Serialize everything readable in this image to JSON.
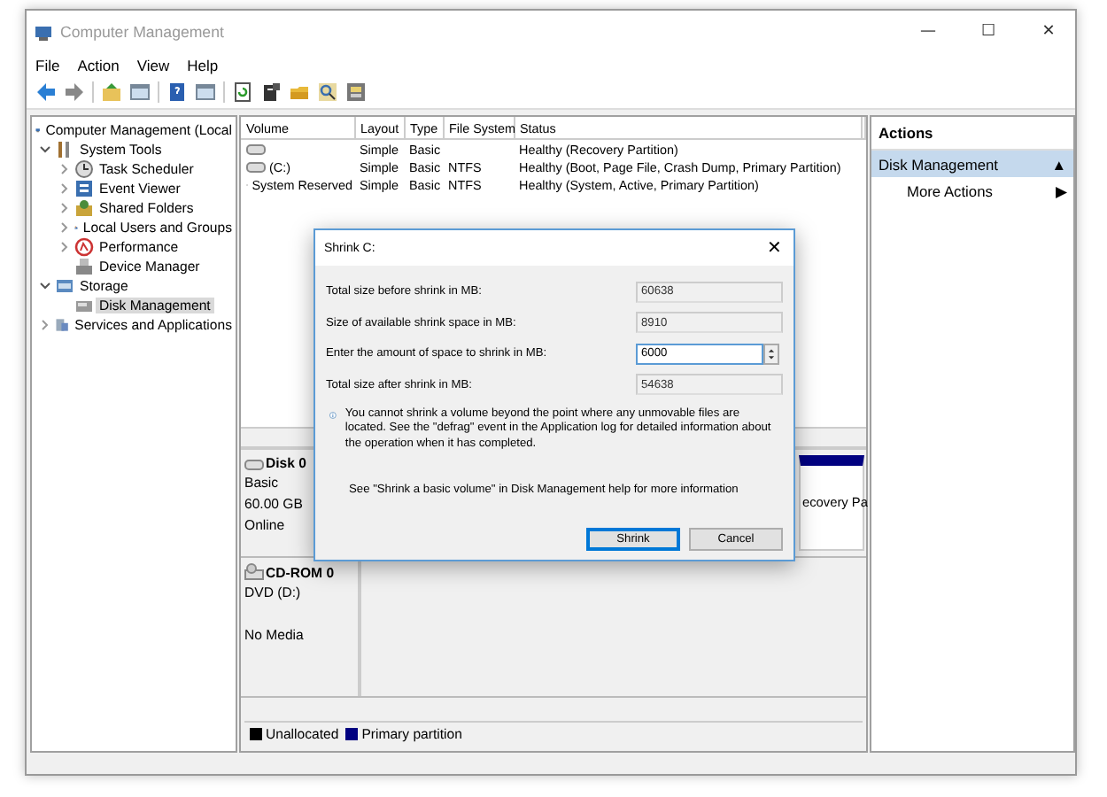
{
  "window": {
    "title": "Computer Management",
    "controls": [
      "—",
      "☐",
      "✕"
    ]
  },
  "menu": [
    "File",
    "Action",
    "View",
    "Help"
  ],
  "tree": [
    {
      "label": "Computer Management (Local",
      "kind": "root",
      "selected": false,
      "children": [
        {
          "label": "System Tools",
          "kind": "group",
          "expanded": true,
          "selected": false,
          "children": [
            {
              "label": "Task Scheduler",
              "kind": "group",
              "expanded": false,
              "selected": false
            },
            {
              "label": "Event Viewer",
              "kind": "group",
              "expanded": false,
              "selected": false
            },
            {
              "label": "Shared Folders",
              "kind": "group",
              "expanded": false,
              "selected": false
            },
            {
              "label": "Local Users and Groups",
              "kind": "group",
              "expanded": false,
              "selected": false
            },
            {
              "label": "Performance",
              "kind": "group",
              "expanded": false,
              "selected": false
            },
            {
              "label": "Device Manager",
              "kind": "leaf",
              "selected": false
            }
          ]
        },
        {
          "label": "Storage",
          "kind": "group",
          "expanded": true,
          "selected": false,
          "children": [
            {
              "label": "Disk Management",
              "kind": "leaf",
              "selected": true
            }
          ]
        },
        {
          "label": "Services and Applications",
          "kind": "group",
          "expanded": false,
          "selected": false
        }
      ]
    }
  ],
  "table": {
    "columns": [
      "Volume",
      "Layout",
      "Type",
      "File System",
      "Status"
    ],
    "rows": [
      {
        "volume": "",
        "layout": "Simple",
        "type": "Basic",
        "file_system": "",
        "status": "Healthy (Recovery Partition)"
      },
      {
        "volume": "(C:)",
        "layout": "Simple",
        "type": "Basic",
        "file_system": "NTFS",
        "status": "Healthy (Boot, Page File, Crash Dump, Primary Partition)"
      },
      {
        "volume": "System Reserved",
        "layout": "Simple",
        "type": "Basic",
        "file_system": "NTFS",
        "status": "Healthy (System, Active, Primary Partition)"
      }
    ]
  },
  "disks": [
    {
      "name": "Disk 0",
      "type": "Basic",
      "size": "60.00 GB",
      "status": "Online",
      "partition": "ecovery Pa"
    },
    {
      "name": "CD-ROM 0",
      "type": "DVD (D:)",
      "status": "No Media"
    }
  ],
  "legend": [
    {
      "label": "Unallocated",
      "color": "#000000"
    },
    {
      "label": "Primary partition",
      "color": "#000080"
    }
  ],
  "actions": {
    "title": "Actions",
    "items": [
      {
        "label": "Disk Management",
        "kind": "header",
        "marker": "▲"
      },
      {
        "label": "More Actions",
        "kind": "item",
        "marker": "▶"
      }
    ]
  },
  "dialog": {
    "title": "Shrink C:",
    "close": "✕",
    "fields": [
      {
        "label": "Total size before shrink in MB:",
        "value": "60638",
        "editable": false
      },
      {
        "label": "Size of available shrink space in MB:",
        "value": "8910",
        "editable": false
      },
      {
        "label": "Enter the amount of space to shrink in MB:",
        "value": "6000",
        "editable": true
      },
      {
        "label": "Total size after shrink in MB:",
        "value": "54638",
        "editable": false
      }
    ],
    "info": "You cannot shrink a volume beyond the point where any unmovable files are located. See the \"defrag\" event in the Application log for detailed information about the operation when it has completed.",
    "help": "See \"Shrink a basic volume\" in Disk Management help for more information",
    "buttons": [
      {
        "label": "Shrink",
        "default": true
      },
      {
        "label": "Cancel",
        "default": false
      }
    ]
  }
}
